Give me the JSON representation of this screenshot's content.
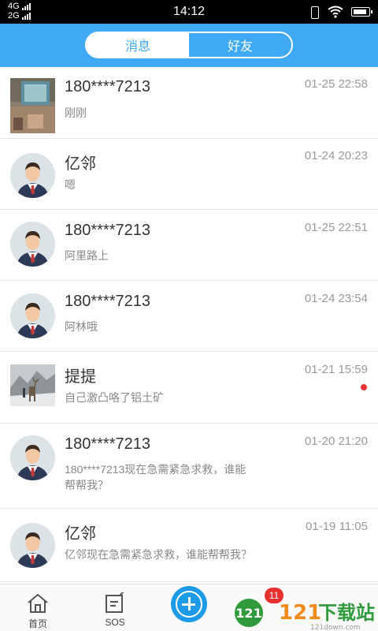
{
  "status_bar": {
    "network_top": "4G",
    "network_bottom": "2G",
    "time": "14:12"
  },
  "header": {
    "tabs": [
      {
        "label": "消息",
        "active": true
      },
      {
        "label": "好友",
        "active": false
      }
    ],
    "accent_color": "#3fa9f5"
  },
  "conversations": [
    {
      "name": "180****7213",
      "time": "01-25 22:58",
      "message": "刚刚",
      "avatar": "photo-room",
      "unread": false
    },
    {
      "name": "亿邻",
      "time": "01-24 20:23",
      "message": "嗯",
      "avatar": "default-user",
      "unread": false
    },
    {
      "name": "180****7213",
      "time": "01-25 22:51",
      "message": "阿里路上",
      "avatar": "default-user",
      "unread": false
    },
    {
      "name": "180****7213",
      "time": "01-24 23:54",
      "message": "阿林哦",
      "avatar": "default-user",
      "unread": false
    },
    {
      "name": "提提",
      "time": "01-21 15:59",
      "message": "自己激凸咯了铝土矿",
      "avatar": "photo-deer",
      "unread": true
    },
    {
      "name": "180****7213",
      "time": "01-20 21:20",
      "message_line1": "180****7213现在急需紧急求救，谁能",
      "message_line2": "帮帮我？",
      "avatar": "default-user",
      "unread": false
    },
    {
      "name": "亿邻",
      "time": "01-19 11:05",
      "message": "亿邻现在急需紧急求救，谁能帮帮我？",
      "avatar": "default-user",
      "unread": false
    }
  ],
  "tab_bar": {
    "home_label": "首页",
    "sos_label": "SOS",
    "badge_count": "11",
    "watermark": "121下载站",
    "watermark_url": "121down.com"
  },
  "colors": {
    "unread_dot": "#e83030",
    "plus_button": "#1e9be8"
  }
}
